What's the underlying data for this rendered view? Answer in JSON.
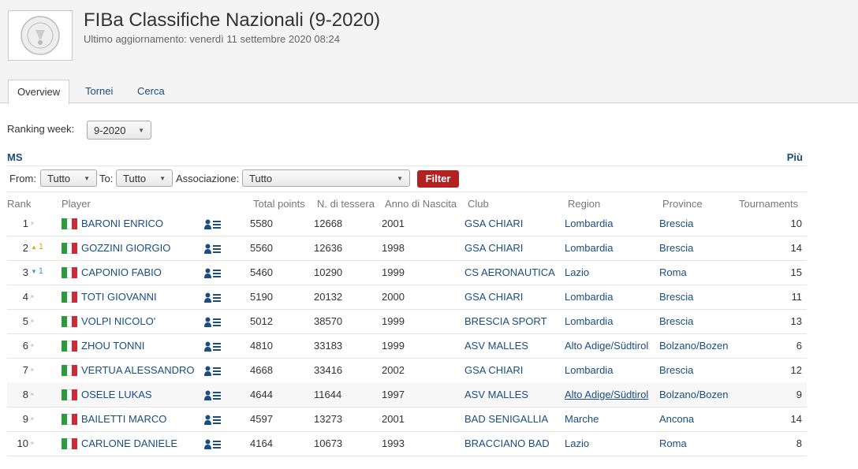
{
  "header": {
    "title": "FIBa Classifiche Nazionali (9-2020)",
    "subtitle": "Ultimo aggiornamento: venerdì 11 settembre 2020 08:24",
    "logo_text": "BADMINTON"
  },
  "tabs": [
    {
      "label": "Overview",
      "active": true
    },
    {
      "label": "Tornei",
      "active": false
    },
    {
      "label": "Cerca",
      "active": false
    }
  ],
  "ranking_week": {
    "label": "Ranking week:",
    "value": "9-2020"
  },
  "section": {
    "title": "MS",
    "more": "Più"
  },
  "filters": {
    "from_label": "From:",
    "from_value": "Tutto",
    "to_label": "To:",
    "to_value": "Tutto",
    "assoc_label": "Associazione:",
    "assoc_value": "Tutto",
    "button": "Filter"
  },
  "columns": [
    "Rank",
    "Player",
    "Total points",
    "N. di tessera",
    "Anno di Nascita",
    "Club",
    "Region",
    "Province",
    "Tournaments"
  ],
  "rows": [
    {
      "rank": "1",
      "move": "none",
      "move_value": "",
      "player": "BARONI ENRICO",
      "points": "5580",
      "tessera": "12668",
      "anno": "2001",
      "club": "GSA CHIARI",
      "region": "Lombardia",
      "province": "Brescia",
      "tournaments": "10"
    },
    {
      "rank": "2",
      "move": "up",
      "move_value": "1",
      "player": "GOZZINI GIORGIO",
      "points": "5560",
      "tessera": "12636",
      "anno": "1998",
      "club": "GSA CHIARI",
      "region": "Lombardia",
      "province": "Brescia",
      "tournaments": "14"
    },
    {
      "rank": "3",
      "move": "down",
      "move_value": "1",
      "player": "CAPONIO FABIO",
      "points": "5460",
      "tessera": "10290",
      "anno": "1999",
      "club": "CS AERONAUTICA",
      "region": "Lazio",
      "province": "Roma",
      "tournaments": "15"
    },
    {
      "rank": "4",
      "move": "none",
      "move_value": "",
      "player": "TOTI GIOVANNI",
      "points": "5190",
      "tessera": "20132",
      "anno": "2000",
      "club": "GSA CHIARI",
      "region": "Lombardia",
      "province": "Brescia",
      "tournaments": "11"
    },
    {
      "rank": "5",
      "move": "none",
      "move_value": "",
      "player": "VOLPI NICOLO'",
      "points": "5012",
      "tessera": "38570",
      "anno": "1999",
      "club": "BRESCIA SPORT",
      "region": "Lombardia",
      "province": "Brescia",
      "tournaments": "13"
    },
    {
      "rank": "6",
      "move": "none",
      "move_value": "",
      "player": "ZHOU TONNI",
      "points": "4810",
      "tessera": "33183",
      "anno": "1999",
      "club": "ASV MALLES",
      "region": "Alto Adige/Südtirol",
      "province": "Bolzano/Bozen",
      "tournaments": "6"
    },
    {
      "rank": "7",
      "move": "none",
      "move_value": "",
      "player": "VERTUA ALESSANDRO",
      "points": "4668",
      "tessera": "33416",
      "anno": "2002",
      "club": "GSA CHIARI",
      "region": "Lombardia",
      "province": "Brescia",
      "tournaments": "12"
    },
    {
      "rank": "8",
      "move": "none",
      "move_value": "",
      "player": "OSELE LUKAS",
      "points": "4644",
      "tessera": "11644",
      "anno": "1997",
      "club": "ASV MALLES",
      "region": "Alto Adige/Südtirol",
      "province": "Bolzano/Bozen",
      "tournaments": "9"
    },
    {
      "rank": "9",
      "move": "none",
      "move_value": "",
      "player": "BAILETTI MARCO",
      "points": "4597",
      "tessera": "13273",
      "anno": "2001",
      "club": "BAD SENIGALLIA",
      "region": "Marche",
      "province": "Ancona",
      "tournaments": "14"
    },
    {
      "rank": "10",
      "move": "none",
      "move_value": "",
      "player": "CARLONE DANIELE",
      "points": "4164",
      "tessera": "10673",
      "anno": "1993",
      "club": "BRACCIANO BAD",
      "region": "Lazio",
      "province": "Roma",
      "tournaments": "8"
    }
  ],
  "colors": {
    "link": "#1a4d80",
    "filter_button": "#b22222",
    "move_up": "#e8a015",
    "move_down": "#3aa0c8"
  },
  "flag_colors": [
    "#2e9a3e",
    "#ffffff",
    "#ce2b37"
  ]
}
